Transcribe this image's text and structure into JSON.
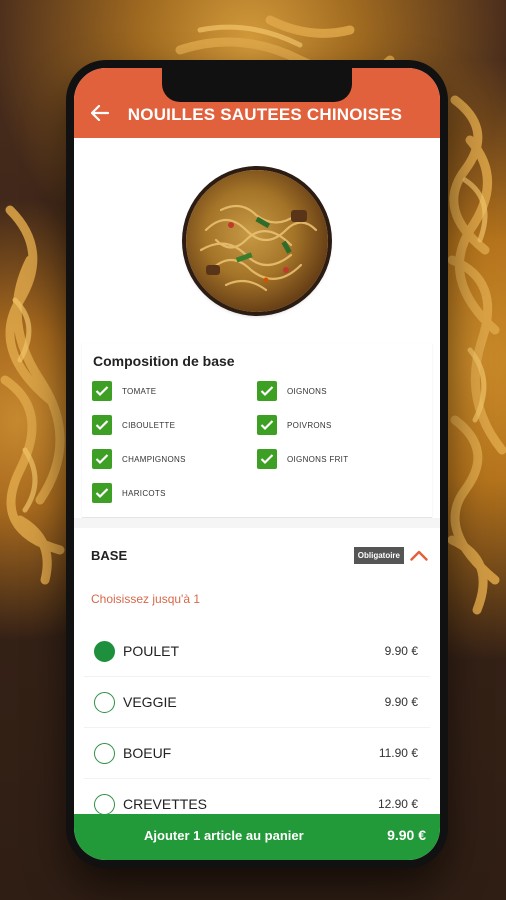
{
  "header": {
    "title": "NOUILLES SAUTEES CHINOISES",
    "back_icon": "arrow-left-icon"
  },
  "composition": {
    "title": "Composition de base",
    "items": [
      {
        "label": "TOMATE",
        "checked": true
      },
      {
        "label": "OIGNONS",
        "checked": true
      },
      {
        "label": "CIBOULETTE",
        "checked": true
      },
      {
        "label": "POIVRONS",
        "checked": true
      },
      {
        "label": "CHAMPIGNONS",
        "checked": true
      },
      {
        "label": "OIGNONS FRIT",
        "checked": true
      },
      {
        "label": "HARICOTS",
        "checked": true
      }
    ]
  },
  "base": {
    "title": "BASE",
    "badge": "Obligatoire",
    "subtitle": "Choisissez jusqu'à 1",
    "options": [
      {
        "label": "POULET",
        "price": "9.90 €",
        "selected": true
      },
      {
        "label": "VEGGIE",
        "price": "9.90 €",
        "selected": false
      },
      {
        "label": "BOEUF",
        "price": "11.90 €",
        "selected": false
      },
      {
        "label": "CREVETTES",
        "price": "12.90 €",
        "selected": false
      }
    ]
  },
  "cart": {
    "label": "Ajouter 1 article au panier",
    "price": "9.90 €"
  },
  "colors": {
    "header": "#e2613d",
    "check": "#3e9f25",
    "cart": "#239a3a",
    "accent_text": "#d8684a"
  }
}
